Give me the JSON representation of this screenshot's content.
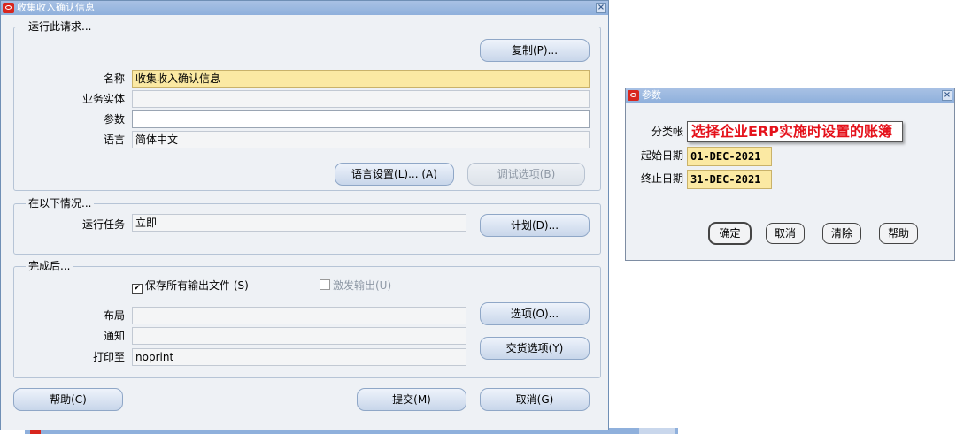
{
  "main_window": {
    "title": "收集收入确认信息",
    "run_request": {
      "group_title": "运行此请求...",
      "copy_button": "复制(P)...",
      "name_label": "名称",
      "name_value": "收集收入确认信息",
      "org_label": "业务实体",
      "org_value": "",
      "params_label": "参数",
      "params_value": "",
      "lang_label": "语言",
      "lang_value": "简体中文",
      "lang_settings_button": "语言设置(L)... (A)",
      "debug_button": "调试选项(B)"
    },
    "schedule": {
      "group_title": "在以下情况...",
      "run_job_label": "运行任务",
      "run_job_value": "立即",
      "schedule_button": "计划(D)..."
    },
    "completion": {
      "group_title": "完成后...",
      "save_output_label": "保存所有输出文件 (S)",
      "save_output_checked": true,
      "burst_output_label": "激发输出(U)",
      "burst_output_checked": false,
      "layout_label": "布局",
      "layout_value": "",
      "options_button": "选项(O)...",
      "notify_label": "通知",
      "notify_value": "",
      "print_to_label": "打印至",
      "print_to_value": "noprint",
      "delivery_button": "交货选项(Y)"
    },
    "help_button": "帮助(C)",
    "submit_button": "提交(M)",
    "cancel_button": "取消(G)"
  },
  "params_dialog": {
    "title": "参数",
    "ledger_label": "分类帐",
    "ledger_value": "选择企业ERP实施时设置的账簿",
    "start_date_label": "起始日期",
    "start_date_value": "01-DEC-2021",
    "end_date_label": "终止日期",
    "end_date_value": "31-DEC-2021",
    "ok_button": "确定",
    "cancel_button": "取消",
    "clear_button": "清除",
    "help_button": "帮助"
  },
  "colors": {
    "title_bar": "#8fb0dc",
    "window_bg": "#eef1f5",
    "required_field": "#fbe9a3",
    "annotation_red": "#e5121b",
    "logo_red": "#d8261e"
  }
}
